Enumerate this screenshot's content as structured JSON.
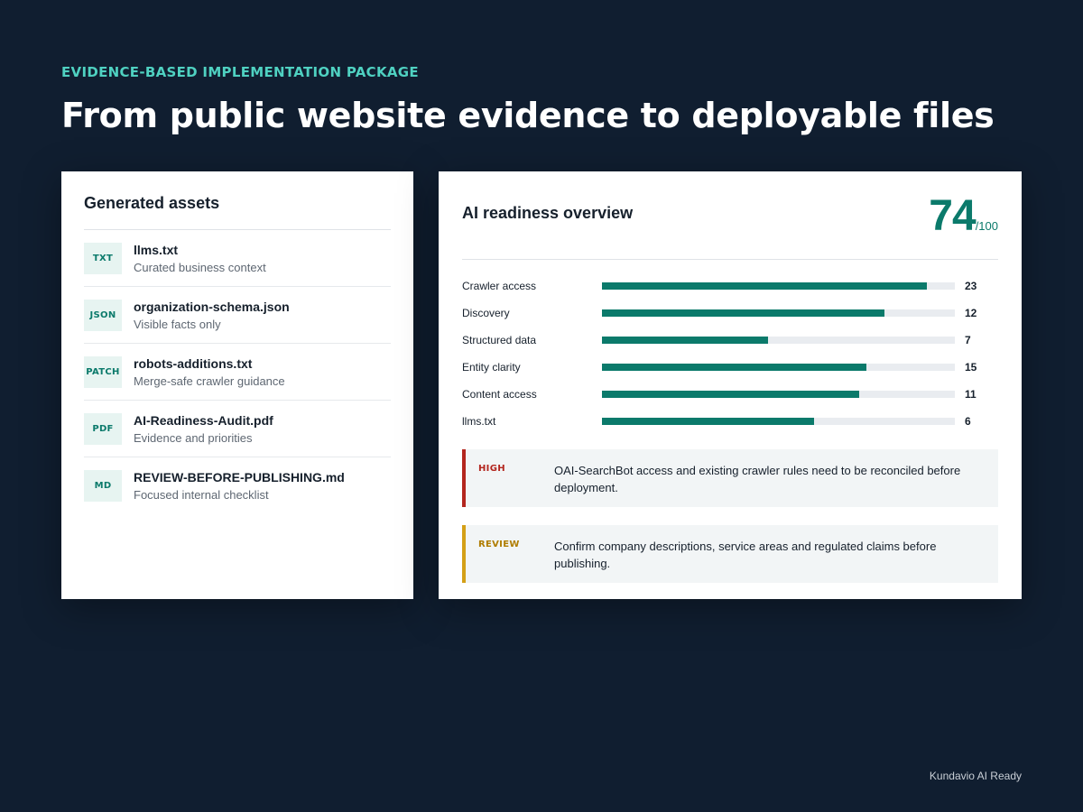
{
  "eyebrow": "EVIDENCE-BASED IMPLEMENTATION PACKAGE",
  "headline": "From public website evidence to deployable files",
  "assets": {
    "title": "Generated assets",
    "items": [
      {
        "badge": "TXT",
        "name": "llms.txt",
        "desc": "Curated business context"
      },
      {
        "badge": "JSON",
        "name": "organization-schema.json",
        "desc": "Visible facts only"
      },
      {
        "badge": "PATCH",
        "name": "robots-additions.txt",
        "desc": "Merge-safe crawler guidance"
      },
      {
        "badge": "PDF",
        "name": "AI-Readiness-Audit.pdf",
        "desc": "Evidence and priorities"
      },
      {
        "badge": "MD",
        "name": "REVIEW-BEFORE-PUBLISHING.md",
        "desc": "Focused internal checklist"
      }
    ]
  },
  "overview": {
    "title": "AI readiness overview",
    "score": "74",
    "score_max": "/100",
    "bar_scale_max": 25,
    "bars": [
      {
        "label": "Crawler access",
        "value": 23
      },
      {
        "label": "Discovery",
        "value": 12
      },
      {
        "label": "Structured data",
        "value": 7
      },
      {
        "label": "Entity clarity",
        "value": 15
      },
      {
        "label": "Content access",
        "value": 11
      },
      {
        "label": "llms.txt",
        "value": 6
      }
    ],
    "bar_fill_fraction": [
      0.92,
      0.8,
      0.47,
      0.75,
      0.73,
      0.6
    ],
    "callouts": [
      {
        "tag": "HIGH",
        "text": "OAI-SearchBot access and existing crawler rules need to be reconciled before deployment."
      },
      {
        "tag": "REVIEW",
        "text": "Confirm company descriptions, service areas and regulated claims before publishing."
      }
    ]
  },
  "footer": "Kundavio AI Ready",
  "colors": {
    "background": "#101e30",
    "accent": "#0b7a6b",
    "eyebrow": "#4fd1c1",
    "high": "#b3261e",
    "review": "#d4a017"
  }
}
